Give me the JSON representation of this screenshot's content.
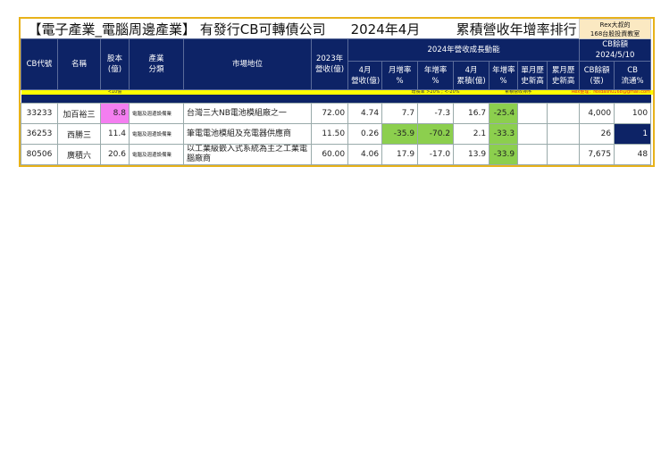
{
  "title": {
    "main": "【電子產業_電腦周邊產業】 有發行CB可轉債公司",
    "period": "2024年4月",
    "ranking": "累積營收年增率排行",
    "brand_line1": "Rex大叔的",
    "brand_line2": "168台股投資教室"
  },
  "headers": {
    "code": "CB代號",
    "name": "名稱",
    "capital": "股本\n(億)",
    "industry": "產業\n分類",
    "market": "市場地位",
    "rev2023": "2023年\n營收(億)",
    "group2024": "2024年營收成長動能",
    "cb_group": "CB餘額\n2024/5/10",
    "apr_rev": "4月\n營收(億)",
    "mom": "月增率\n%",
    "yoy": "年增率\n%",
    "apr_cum": "4月\n累積(億)",
    "cum_yoy": "年增率\n%",
    "month_high": "單月歷\n史新高",
    "cum_high": "累月歷\n史新高",
    "cb_balance": "CB餘額\n(張)",
    "cb_float": "CB\n流通%"
  },
  "notes": {
    "capital": "<10億",
    "growth": "增長率 >20% ; <-20%",
    "sort": "累積營收排序",
    "contact": "Rex整理：rexdashu168@gmail.com"
  },
  "rows": [
    {
      "code": "33233",
      "name": "加百裕三",
      "capital": "8.8",
      "industry": "電腦及週邊設備業",
      "market": "台灣三大NB電池模組廠之一",
      "rev2023": "72.00",
      "apr_rev": "4.74",
      "mom": "7.7",
      "yoy": "-7.3",
      "apr_cum": "16.7",
      "cum_yoy": "-25.4",
      "month_high": "",
      "cum_high": "",
      "cb_balance": "4,000",
      "cb_float": "100"
    },
    {
      "code": "36253",
      "name": "西勝三",
      "capital": "11.4",
      "industry": "電腦及週邊設備業",
      "market": "筆電電池模組及充電器供應商",
      "rev2023": "11.50",
      "apr_rev": "0.26",
      "mom": "-35.9",
      "yoy": "-70.2",
      "apr_cum": "2.1",
      "cum_yoy": "-33.3",
      "month_high": "",
      "cum_high": "",
      "cb_balance": "26",
      "cb_float": "1"
    },
    {
      "code": "80506",
      "name": "廣積六",
      "capital": "20.6",
      "industry": "電腦及週邊設備業",
      "market": "以工業級嵌入式系統為主之工業電腦廠商",
      "rev2023": "60.00",
      "apr_rev": "4.06",
      "mom": "17.9",
      "yoy": "-17.0",
      "apr_cum": "13.9",
      "cum_yoy": "-33.9",
      "month_high": "",
      "cum_high": "",
      "cb_balance": "7,675",
      "cb_float": "48"
    }
  ]
}
